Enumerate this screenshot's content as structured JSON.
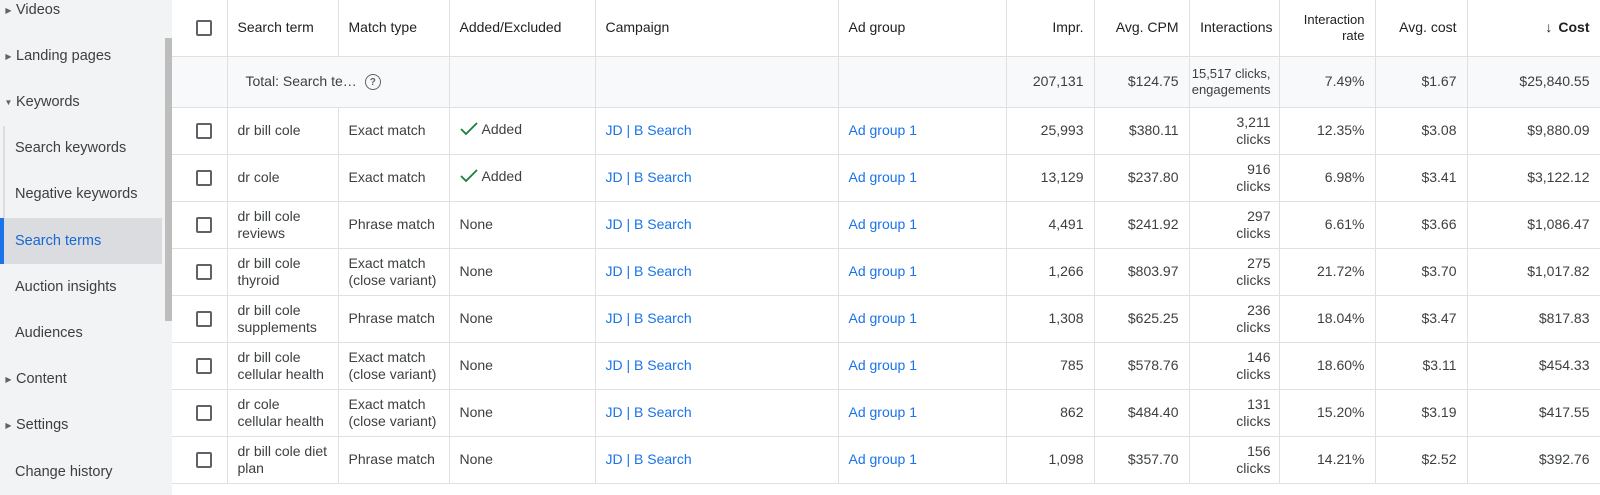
{
  "sidebar": {
    "items": [
      {
        "label": "Videos"
      },
      {
        "label": "Landing pages"
      },
      {
        "label": "Keywords"
      },
      {
        "label": "Search keywords"
      },
      {
        "label": "Negative keywords"
      },
      {
        "label": "Search terms"
      },
      {
        "label": "Auction insights"
      },
      {
        "label": "Audiences"
      },
      {
        "label": "Content"
      },
      {
        "label": "Settings"
      },
      {
        "label": "Change history"
      }
    ]
  },
  "table": {
    "headers": {
      "search_term": "Search term",
      "match_type": "Match type",
      "added_excluded": "Added/Excluded",
      "campaign": "Campaign",
      "ad_group": "Ad group",
      "impr": "Impr.",
      "avg_cpm": "Avg. CPM",
      "interactions": "Interactions",
      "interaction_rate": "Interaction rate",
      "avg_cost": "Avg. cost",
      "cost": "Cost"
    },
    "total": {
      "label": "Total: Search te…",
      "impr": "207,131",
      "avg_cpm": "$124.75",
      "interactions": "15,517 clicks, engagements",
      "interaction_rate": "7.49%",
      "avg_cost": "$1.67",
      "cost": "$25,840.55"
    },
    "rows": [
      {
        "term": "dr bill cole",
        "match": "Exact match",
        "status": "Added",
        "campaign": "JD | B Search",
        "ad_group": "Ad group 1",
        "impr": "25,993",
        "cpm": "$380.11",
        "interactions": "3,211 clicks",
        "rate": "12.35%",
        "avg_cost": "$3.08",
        "cost": "$9,880.09"
      },
      {
        "term": "dr cole",
        "match": "Exact match",
        "status": "Added",
        "campaign": "JD | B Search",
        "ad_group": "Ad group 1",
        "impr": "13,129",
        "cpm": "$237.80",
        "interactions": "916 clicks",
        "rate": "6.98%",
        "avg_cost": "$3.41",
        "cost": "$3,122.12"
      },
      {
        "term": "dr bill cole reviews",
        "match": "Phrase match",
        "status": "None",
        "campaign": "JD | B Search",
        "ad_group": "Ad group 1",
        "impr": "4,491",
        "cpm": "$241.92",
        "interactions": "297 clicks",
        "rate": "6.61%",
        "avg_cost": "$3.66",
        "cost": "$1,086.47"
      },
      {
        "term": "dr bill cole thyroid",
        "match": "Exact match (close variant)",
        "status": "None",
        "campaign": "JD | B Search",
        "ad_group": "Ad group 1",
        "impr": "1,266",
        "cpm": "$803.97",
        "interactions": "275 clicks",
        "rate": "21.72%",
        "avg_cost": "$3.70",
        "cost": "$1,017.82"
      },
      {
        "term": "dr bill cole supplements",
        "match": "Phrase match",
        "status": "None",
        "campaign": "JD | B Search",
        "ad_group": "Ad group 1",
        "impr": "1,308",
        "cpm": "$625.25",
        "interactions": "236 clicks",
        "rate": "18.04%",
        "avg_cost": "$3.47",
        "cost": "$817.83"
      },
      {
        "term": "dr bill cole cellular health",
        "match": "Exact match (close variant)",
        "status": "None",
        "campaign": "JD | B Search",
        "ad_group": "Ad group 1",
        "impr": "785",
        "cpm": "$578.76",
        "interactions": "146 clicks",
        "rate": "18.60%",
        "avg_cost": "$3.11",
        "cost": "$454.33"
      },
      {
        "term": "dr cole cellular health",
        "match": "Exact match (close variant)",
        "status": "None",
        "campaign": "JD | B Search",
        "ad_group": "Ad group 1",
        "impr": "862",
        "cpm": "$484.40",
        "interactions": "131 clicks",
        "rate": "15.20%",
        "avg_cost": "$3.19",
        "cost": "$417.55"
      },
      {
        "term": "dr bill cole diet plan",
        "match": "Phrase match",
        "status": "None",
        "campaign": "JD | B Search",
        "ad_group": "Ad group 1",
        "impr": "1,098",
        "cpm": "$357.70",
        "interactions": "156 clicks",
        "rate": "14.21%",
        "avg_cost": "$2.52",
        "cost": "$392.76"
      }
    ]
  },
  "colors": {
    "link": "#1a73e8",
    "added_check": "#188038",
    "active_nav": "#1967d2"
  }
}
